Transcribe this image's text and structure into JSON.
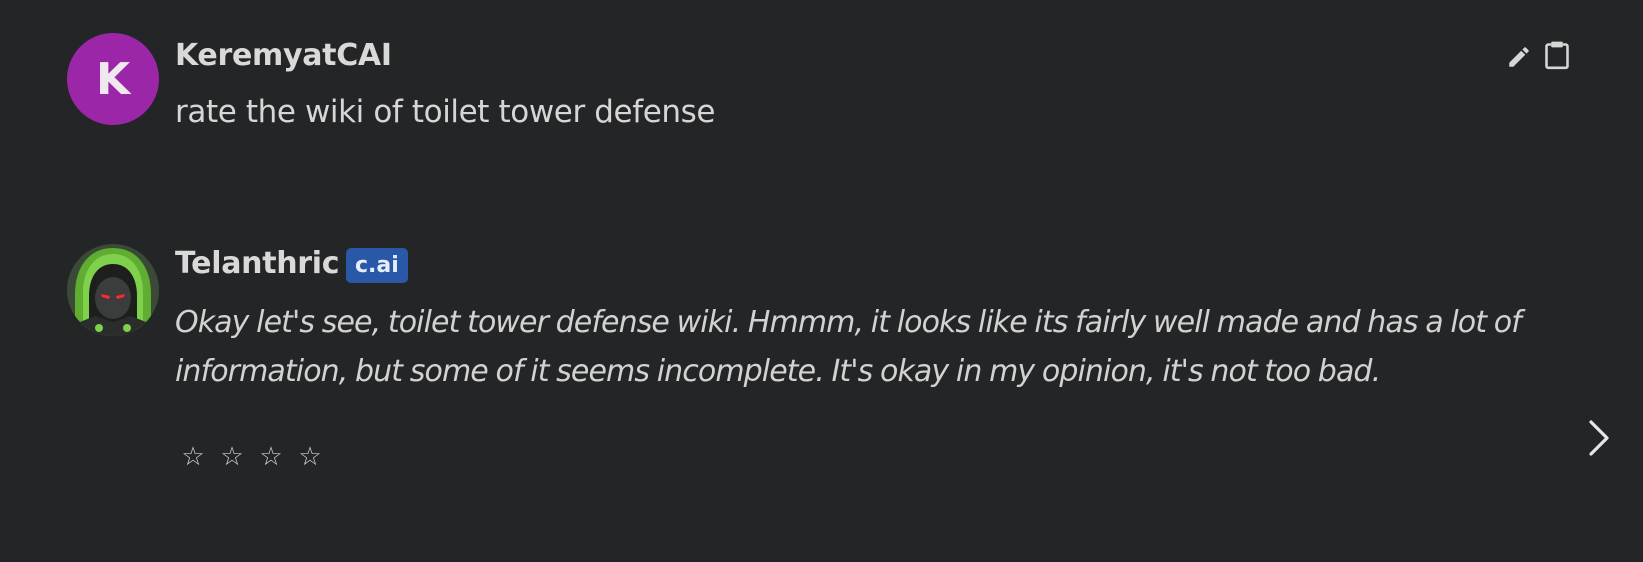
{
  "messages": [
    {
      "author": "KeremyatCAI",
      "avatar_letter": "K",
      "avatar_color": "#9b27a8",
      "text": "rate the wiki of toilet tower defense",
      "actions": [
        "edit-icon",
        "clipboard-icon"
      ]
    },
    {
      "author": "Telanthric",
      "badge": "c.ai",
      "badge_color": "#2a58a8",
      "text": "Okay let's see, toilet tower defense wiki. Hmmm, it looks like its fairly well made and has a lot of information, but some of it seems incomplete. It's okay in my opinion, it's not too bad.",
      "rating": {
        "stars": [
          "☆",
          "☆",
          "☆",
          "☆"
        ],
        "filled": 0
      },
      "next_icon": "chevron-right-icon"
    }
  ],
  "colors": {
    "background": "#242526",
    "text": "#d6d6d6"
  }
}
